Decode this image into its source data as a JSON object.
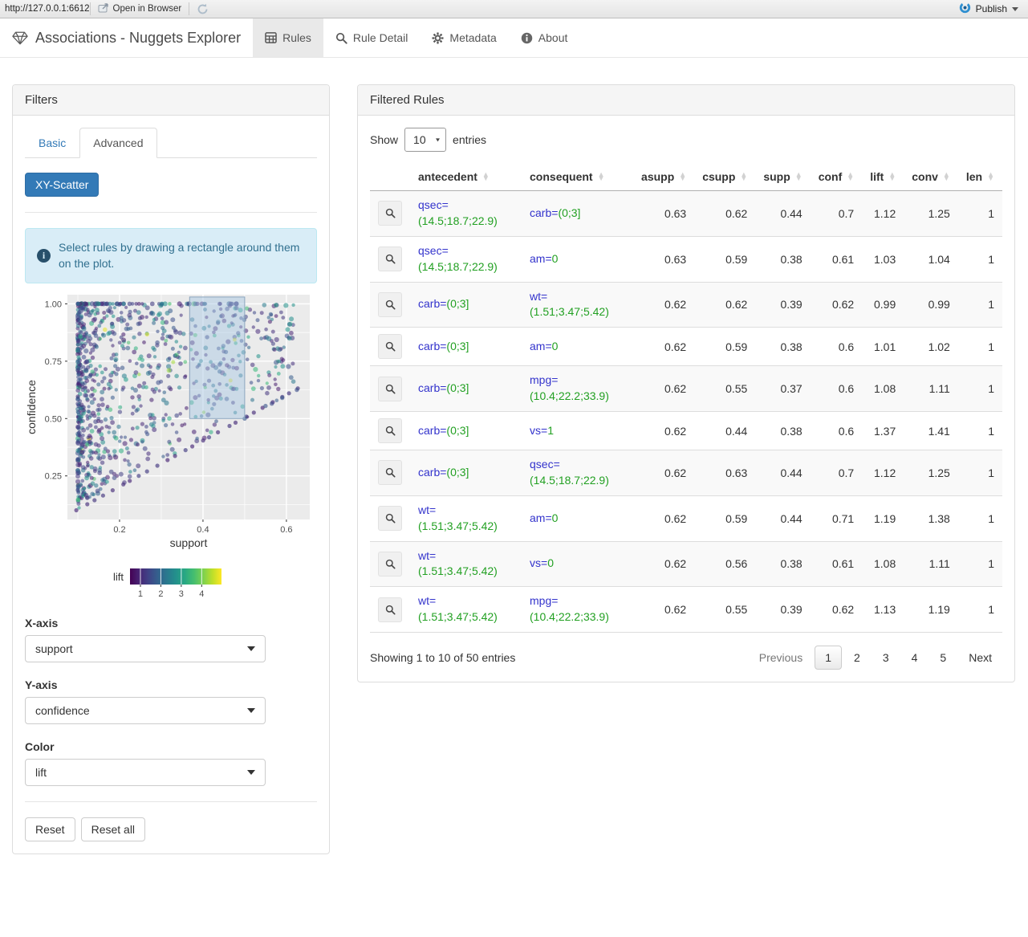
{
  "viewer_bar": {
    "url": "http://127.0.0.1:6612",
    "open_in_browser": "Open in Browser",
    "publish": "Publish"
  },
  "navbar": {
    "brand": "Associations - Nuggets Explorer",
    "tabs": [
      {
        "label": "Rules",
        "icon": "table-icon",
        "active": true
      },
      {
        "label": "Rule Detail",
        "icon": "search-icon",
        "active": false
      },
      {
        "label": "Metadata",
        "icon": "gear-icon",
        "active": false
      },
      {
        "label": "About",
        "icon": "info-icon",
        "active": false
      }
    ]
  },
  "filters": {
    "title": "Filters",
    "tabs": [
      {
        "label": "Basic",
        "active": false
      },
      {
        "label": "Advanced",
        "active": true
      }
    ],
    "scatter_button": "XY-Scatter",
    "info_text": "Select rules by drawing a rectangle around them on the plot.",
    "x_label": "X-axis",
    "x_value": "support",
    "y_label": "Y-axis",
    "y_value": "confidence",
    "color_label": "Color",
    "color_value": "lift",
    "reset_label": "Reset",
    "reset_all_label": "Reset all"
  },
  "chart_data": {
    "type": "scatter",
    "xlabel": "support",
    "ylabel": "confidence",
    "x_ticks": [
      0.2,
      0.4,
      0.6
    ],
    "y_ticks": [
      0.25,
      0.5,
      0.75,
      1.0
    ],
    "xlim": [
      0.075,
      0.656
    ],
    "ylim": [
      0.06,
      1.04
    ],
    "x_minor": [
      0.1,
      0.3,
      0.5
    ],
    "y_minor": [
      0.125,
      0.375,
      0.625,
      0.875
    ],
    "selection_rect": {
      "x": [
        0.368,
        0.5
      ],
      "y": [
        0.5,
        1.03
      ]
    },
    "color_legend": {
      "label": "lift",
      "ticks": [
        1,
        2,
        3,
        4
      ],
      "range": [
        0.49,
        4.97
      ]
    },
    "points_generated": true,
    "generator": {
      "seed": 42,
      "cloud_count": 880,
      "top_count": 62,
      "diag_count": 26,
      "support_min": 0.1,
      "support_span": 0.52,
      "diag_max_support": 0.63
    }
  },
  "rules": {
    "title": "Filtered Rules",
    "show_label": "Show",
    "page_length": "10",
    "entries_label": "entries",
    "columns": [
      "antecedent",
      "consequent",
      "asupp",
      "csupp",
      "supp",
      "conf",
      "lift",
      "conv",
      "len"
    ],
    "rows": [
      {
        "antecedent": {
          "attr": "qsec=",
          "val": "(14.5;18.7;22.9)"
        },
        "consequent": {
          "attr": "carb=",
          "val": "(0;3]"
        },
        "nums": [
          "0.63",
          "0.62",
          "0.44",
          "0.7",
          "1.12",
          "1.25",
          "1"
        ]
      },
      {
        "antecedent": {
          "attr": "qsec=",
          "val": "(14.5;18.7;22.9)"
        },
        "consequent": {
          "attr": "am=",
          "val": "0"
        },
        "nums": [
          "0.63",
          "0.59",
          "0.38",
          "0.61",
          "1.03",
          "1.04",
          "1"
        ]
      },
      {
        "antecedent": {
          "attr": "carb=",
          "val": "(0;3]"
        },
        "consequent": {
          "attr": "wt=",
          "val": "(1.51;3.47;5.42)"
        },
        "nums": [
          "0.62",
          "0.62",
          "0.39",
          "0.62",
          "0.99",
          "0.99",
          "1"
        ]
      },
      {
        "antecedent": {
          "attr": "carb=",
          "val": "(0;3]"
        },
        "consequent": {
          "attr": "am=",
          "val": "0"
        },
        "nums": [
          "0.62",
          "0.59",
          "0.38",
          "0.6",
          "1.01",
          "1.02",
          "1"
        ]
      },
      {
        "antecedent": {
          "attr": "carb=",
          "val": "(0;3]"
        },
        "consequent": {
          "attr": "mpg=",
          "val": "(10.4;22.2;33.9)"
        },
        "nums": [
          "0.62",
          "0.55",
          "0.37",
          "0.6",
          "1.08",
          "1.11",
          "1"
        ]
      },
      {
        "antecedent": {
          "attr": "carb=",
          "val": "(0;3]"
        },
        "consequent": {
          "attr": "vs=",
          "val": "1"
        },
        "nums": [
          "0.62",
          "0.44",
          "0.38",
          "0.6",
          "1.37",
          "1.41",
          "1"
        ]
      },
      {
        "antecedent": {
          "attr": "carb=",
          "val": "(0;3]"
        },
        "consequent": {
          "attr": "qsec=",
          "val": "(14.5;18.7;22.9)"
        },
        "nums": [
          "0.62",
          "0.63",
          "0.44",
          "0.7",
          "1.12",
          "1.25",
          "1"
        ]
      },
      {
        "antecedent": {
          "attr": "wt=",
          "val": "(1.51;3.47;5.42)"
        },
        "consequent": {
          "attr": "am=",
          "val": "0"
        },
        "nums": [
          "0.62",
          "0.59",
          "0.44",
          "0.71",
          "1.19",
          "1.38",
          "1"
        ]
      },
      {
        "antecedent": {
          "attr": "wt=",
          "val": "(1.51;3.47;5.42)"
        },
        "consequent": {
          "attr": "vs=",
          "val": "0"
        },
        "nums": [
          "0.62",
          "0.56",
          "0.38",
          "0.61",
          "1.08",
          "1.11",
          "1"
        ]
      },
      {
        "antecedent": {
          "attr": "wt=",
          "val": "(1.51;3.47;5.42)"
        },
        "consequent": {
          "attr": "mpg=",
          "val": "(10.4;22.2;33.9)"
        },
        "nums": [
          "0.62",
          "0.55",
          "0.39",
          "0.62",
          "1.13",
          "1.19",
          "1"
        ]
      }
    ],
    "info": "Showing 1 to 10 of 50 entries",
    "pagination": {
      "previous": "Previous",
      "pages": [
        "1",
        "2",
        "3",
        "4",
        "5"
      ],
      "current": "1",
      "next": "Next"
    }
  },
  "colors": {
    "primary": "#337ab7",
    "attr_blue": "#3333cc",
    "value_green": "#22a022",
    "alert_bg": "#d9edf7",
    "alert_text": "#31708f",
    "panel_bg": "#ebebeb",
    "viridis": [
      "#440154",
      "#482878",
      "#3e4989",
      "#31688e",
      "#26828e",
      "#1f9e89",
      "#35b779",
      "#6ece58",
      "#b5de2b",
      "#fde725"
    ],
    "selection_fill": "rgba(163,198,226,0.45)",
    "selection_stroke": "#8aa4bd"
  }
}
